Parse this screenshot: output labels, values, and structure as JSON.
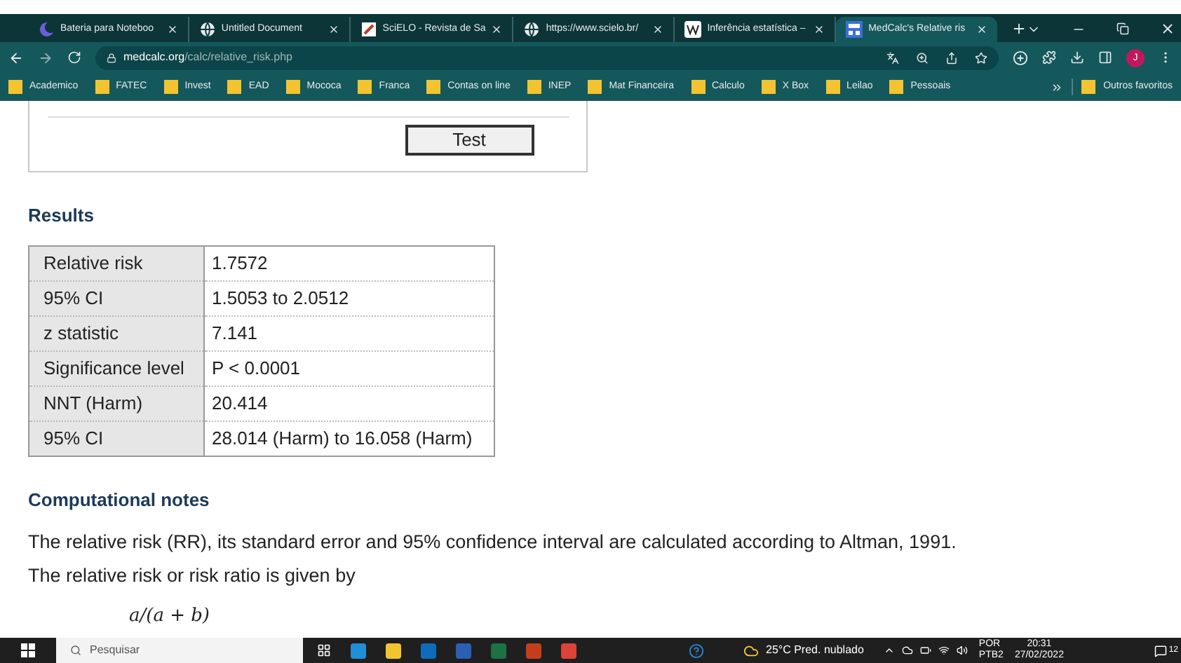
{
  "tabs": [
    {
      "title": "Bateria para Noteboo",
      "selected": false,
      "kind": "moon"
    },
    {
      "title": "Untitled Document",
      "selected": false,
      "kind": "globe"
    },
    {
      "title": "SciELO - Revista de Sa",
      "selected": false,
      "kind": "doc"
    },
    {
      "title": "https://www.scielo.br/",
      "selected": false,
      "kind": "globe"
    },
    {
      "title": "Inferência estatística –",
      "selected": false,
      "kind": "wiki"
    },
    {
      "title": "MedCalc's Relative ris",
      "selected": true,
      "kind": "calc"
    }
  ],
  "address": {
    "domain": "medcalc.org",
    "path": "/calc/relative_risk.php"
  },
  "profile_initial": "J",
  "bookmarks": [
    "Academico",
    "FATEC",
    "Invest",
    "EAD",
    "Mococa",
    "Franca",
    "Contas on line",
    "INEP",
    "Mat Financeira",
    "Calculo",
    "X Box",
    "Leilao",
    "Pessoais"
  ],
  "other_bookmarks": "Outros favoritos",
  "test_button": "Test",
  "results_heading": "Results",
  "results": [
    {
      "label": "Relative risk",
      "value": "1.7572"
    },
    {
      "label": "95% CI",
      "value": "1.5053 to 2.0512"
    },
    {
      "label": "z statistic",
      "value": "7.141"
    },
    {
      "label": "Significance level",
      "value": "P < 0.0001"
    },
    {
      "label": "NNT (Harm)",
      "value": "20.414"
    },
    {
      "label": "95% CI",
      "value": "28.014 (Harm) to 16.058 (Harm)"
    }
  ],
  "notes_heading": "Computational notes",
  "notes": [
    "The relative risk (RR), its standard error and 95% confidence interval are calculated according to Altman, 1991.",
    "The relative risk or risk ratio is given by"
  ],
  "formula": "a/(a + b)",
  "taskbar": {
    "search_placeholder": "Pesquisar",
    "weather": "25°C  Pred. nublado",
    "language": "POR",
    "layout": "PTB2",
    "time": "20:31",
    "date": "27/02/2022",
    "notification_count": "12"
  }
}
